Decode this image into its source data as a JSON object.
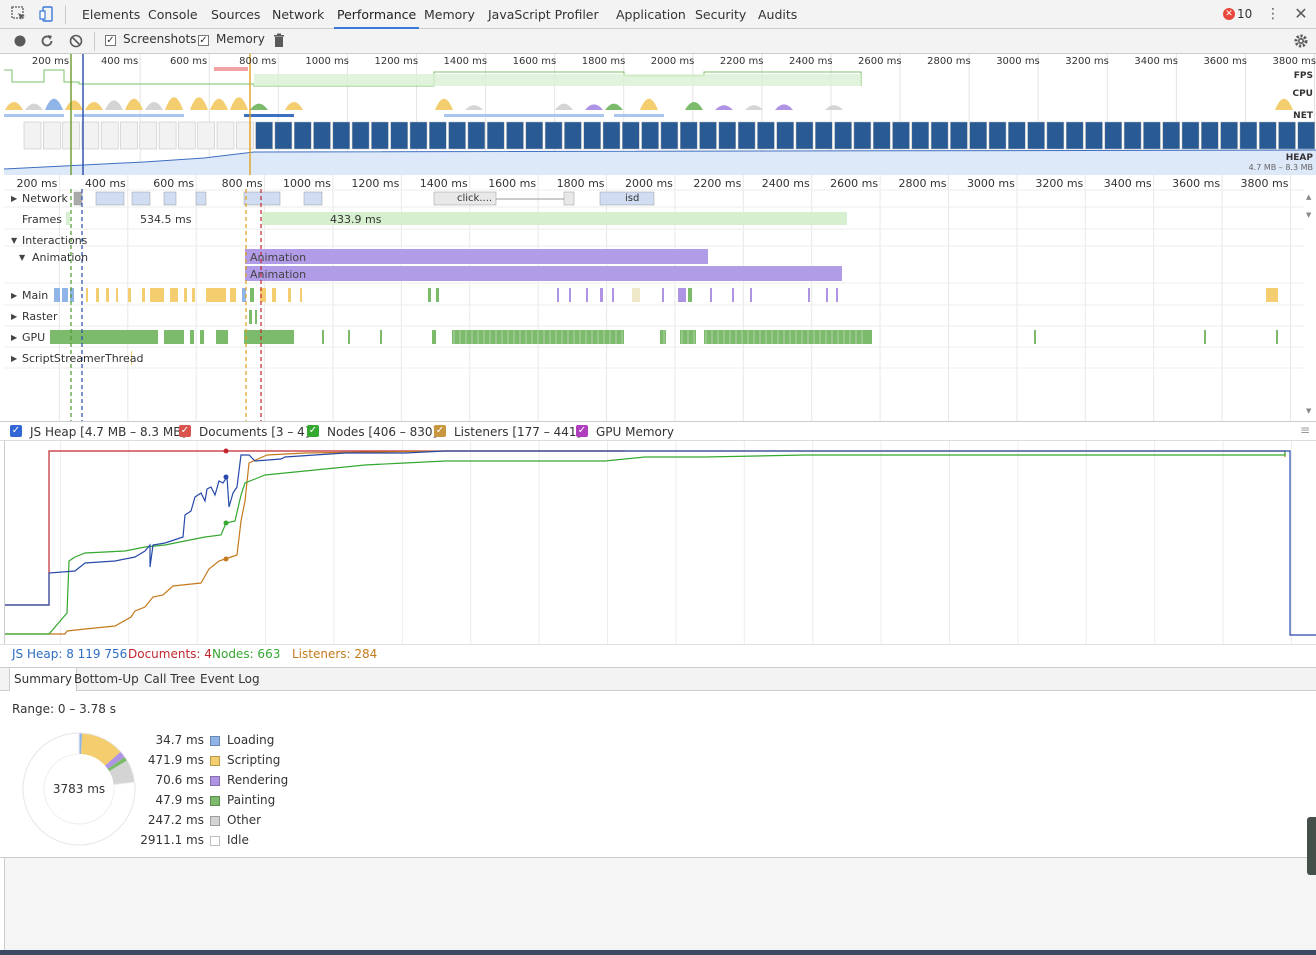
{
  "tabs": [
    {
      "label": "Elements",
      "active": false
    },
    {
      "label": "Console",
      "active": false
    },
    {
      "label": "Sources",
      "active": false
    },
    {
      "label": "Network",
      "active": false
    },
    {
      "label": "Performance",
      "active": true
    },
    {
      "label": "Memory",
      "active": false
    },
    {
      "label": "JavaScript Profiler",
      "active": false
    },
    {
      "label": "Application",
      "active": false
    },
    {
      "label": "Security",
      "active": false
    },
    {
      "label": "Audits",
      "active": false
    }
  ],
  "toolbar_icons": [
    "inspect-element-icon",
    "device-toolbar-icon",
    "record-icon",
    "reload-icon",
    "clear-icon",
    "trash-icon",
    "more-vertical-icon",
    "close-icon",
    "settings-gear-icon"
  ],
  "error_count": "10",
  "toolbar": {
    "screenshots_label": "Screenshots",
    "screenshots_checked": true,
    "memory_label": "Memory",
    "memory_checked": true
  },
  "overview": {
    "ticks": [
      "200 ms",
      "400 ms",
      "600 ms",
      "800 ms",
      "1000 ms",
      "1200 ms",
      "1400 ms",
      "1600 ms",
      "1800 ms",
      "2000 ms",
      "2200 ms",
      "2400 ms",
      "2600 ms",
      "2800 ms",
      "3000 ms",
      "3200 ms",
      "3400 ms",
      "3600 ms",
      "3800 ms"
    ],
    "fps_label": "FPS",
    "cpu_label": "CPU",
    "net_label": "NET",
    "heap_label": "HEAP",
    "heap_range": "4.7 MB – 8.3 MB"
  },
  "timeline": {
    "ticks": [
      "200 ms",
      "400 ms",
      "600 ms",
      "800 ms",
      "1000 ms",
      "1200 ms",
      "1400 ms",
      "1600 ms",
      "1800 ms",
      "2000 ms",
      "2200 ms",
      "2400 ms",
      "2600 ms",
      "2800 ms",
      "3000 ms",
      "3200 ms",
      "3400 ms",
      "3600 ms",
      "3800 ms"
    ],
    "tracks": {
      "network": "Network",
      "frames": "Frames",
      "interactions": "Interactions",
      "animation": "Animation",
      "main": "Main",
      "raster": "Raster",
      "gpu": "GPU",
      "script_streamer": "ScriptStreamerThread"
    },
    "frame_labels": [
      "534.5 ms",
      "433.9 ms"
    ],
    "animation_bars": [
      "Animation",
      "Animation"
    ],
    "network_labels": [
      "click....",
      "isd"
    ]
  },
  "colors": {
    "loading": "#8fb5e8",
    "scripting": "#f3cd6e",
    "rendering": "#af94e6",
    "painting": "#7dbb6c",
    "other": "#d4d4d4",
    "idle": "#ffffff",
    "js_heap": "#2749aa",
    "documents": "#c2272e",
    "nodes": "#34a82f",
    "listeners": "#c47a1c",
    "gpu_memory": "#b03dbe",
    "selection": "#3879d9"
  },
  "memory_legend": [
    {
      "label": "JS Heap [4.7 MB – 8.3 MB]",
      "color": "#3367d6"
    },
    {
      "label": "Documents [3 – 4]",
      "color": "#d9534f"
    },
    {
      "label": "Nodes [406 – 830]",
      "color": "#34a82f"
    },
    {
      "label": "Listeners [177 – 441]",
      "color": "#c8963e"
    },
    {
      "label": "GPU Memory",
      "color": "#b03dbe"
    }
  ],
  "counters": {
    "js_heap": "JS Heap: 8 119 756",
    "documents": "Documents: 4",
    "nodes": "Nodes: 663",
    "listeners": "Listeners: 284"
  },
  "bottom_tabs": [
    {
      "label": "Summary",
      "active": true
    },
    {
      "label": "Bottom-Up",
      "active": false
    },
    {
      "label": "Call Tree",
      "active": false
    },
    {
      "label": "Event Log",
      "active": false
    }
  ],
  "summary": {
    "range": "Range: 0 – 3.78 s",
    "total": "3783 ms",
    "items": [
      {
        "duration": "34.7 ms",
        "label": "Loading",
        "color": "#8fb5e8",
        "value": 34.7
      },
      {
        "duration": "471.9 ms",
        "label": "Scripting",
        "color": "#f3cd6e",
        "value": 471.9
      },
      {
        "duration": "70.6 ms",
        "label": "Rendering",
        "color": "#af94e6",
        "value": 70.6
      },
      {
        "duration": "47.9 ms",
        "label": "Painting",
        "color": "#7dbb6c",
        "value": 47.9
      },
      {
        "duration": "247.2 ms",
        "label": "Other",
        "color": "#d4d4d4",
        "value": 247.2
      },
      {
        "duration": "2911.1 ms",
        "label": "Idle",
        "color": "#ffffff",
        "value": 2911.1
      }
    ]
  }
}
